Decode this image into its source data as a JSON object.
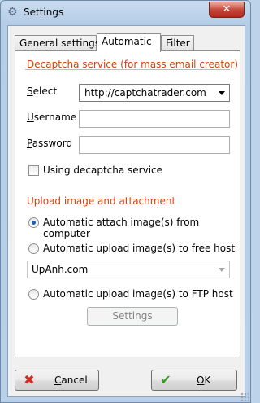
{
  "window": {
    "title": "Settings",
    "close_glyph": "✕"
  },
  "tabs": [
    {
      "label": "General settings"
    },
    {
      "label": "Automatic"
    },
    {
      "label": "Filter"
    }
  ],
  "decaptcha": {
    "group_title": "Decaptcha service (for mass email creator)",
    "select_label_accel": "S",
    "select_label_rest": "elect",
    "select_value": "http://captchatrader.com",
    "username_label_accel": "U",
    "username_label_rest": "sername",
    "username_value": "",
    "password_label_accel": "P",
    "password_label_rest": "assword",
    "password_value": "",
    "use_service_label": "Using decaptcha service",
    "use_service_checked": false
  },
  "upload": {
    "group_title": "Upload image and attachment",
    "option_computer": "Automatic attach image(s) from computer",
    "option_free_host": "Automatic upload image(s) to free host",
    "free_host_value": "UpAnh.com",
    "option_ftp": "Automatic upload image(s) to FTP host",
    "selected": "computer",
    "settings_button": "Settings"
  },
  "footer": {
    "cancel_accel": "C",
    "cancel_rest": "ancel",
    "ok_accel": "O",
    "ok_rest": "K"
  },
  "colors": {
    "group_title": "#d0440f",
    "cancel_icon": "#d42a1f",
    "ok_icon": "#3a9a22",
    "radio_dot": "#1d5fb8"
  },
  "icons": {
    "app": "settings-app-icon",
    "close": "close-icon",
    "dropdown": "chevron-down-icon",
    "cancel": "red-x-icon",
    "ok": "green-check-icon"
  }
}
